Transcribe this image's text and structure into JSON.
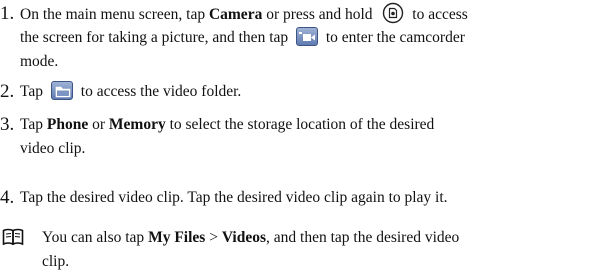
{
  "steps": [
    {
      "number": "1.",
      "lines": [
        [
          "On the main menu screen, tap ",
          "Camera",
          " or press and hold ",
          " to access"
        ],
        [
          "the screen for taking a picture, and then tap ",
          " to enter the camcorder"
        ],
        [
          "mode."
        ]
      ]
    },
    {
      "number": "2.",
      "parts": [
        "Tap ",
        " to access the video folder."
      ]
    },
    {
      "number": "3.",
      "parts": [
        "Tap ",
        "Phone",
        " or ",
        "Memory",
        " to select the storage location of the desired",
        "video clip."
      ]
    },
    {
      "number": "4.",
      "text": "Tap the desired video clip. Tap the desired video clip again to play it."
    }
  ],
  "note": {
    "icon": "book-icon",
    "parts": [
      "You can also tap ",
      "My Files",
      " > ",
      "Videos",
      ", and then tap the desired video",
      "clip."
    ]
  },
  "icons": {
    "hold_key": "camera-key-icon",
    "camcorder_mode": "camcorder-mode-icon",
    "video_folder": "folder-icon"
  }
}
